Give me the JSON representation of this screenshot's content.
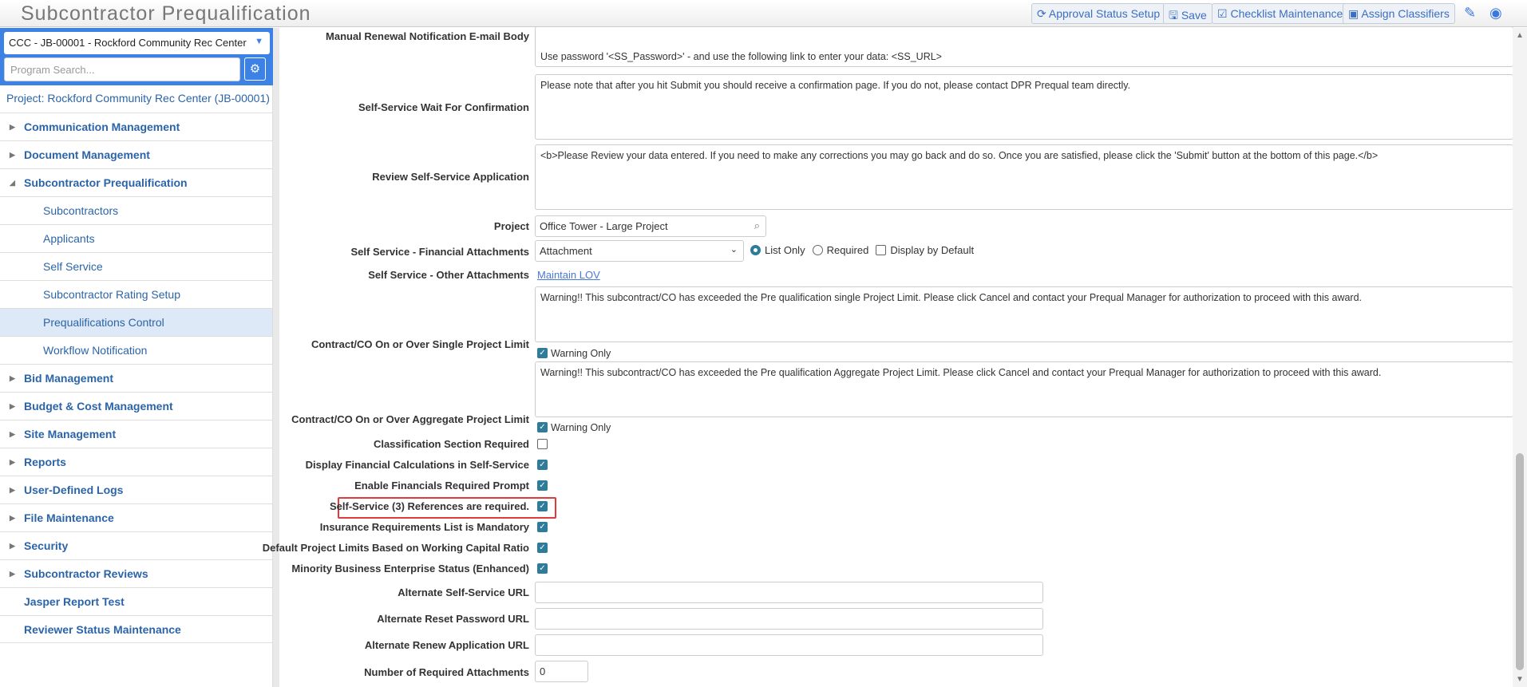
{
  "app_title": "Subcontractor Prequalification",
  "toolbar": {
    "approval": "Approval Status Setup",
    "save": "Save",
    "checklist": "Checklist Maintenance",
    "classifiers": "Assign Classifiers"
  },
  "sidebar": {
    "project_select": "CCC - JB-00001 - Rockford Community Rec Center",
    "search_placeholder": "Program Search...",
    "project_link": "Project: Rockford Community Rec Center (JB-00001)",
    "items": [
      {
        "label": "Communication Management"
      },
      {
        "label": "Document Management"
      },
      {
        "label": "Subcontractor Prequalification"
      },
      {
        "label": "Subcontractors"
      },
      {
        "label": "Applicants"
      },
      {
        "label": "Self Service"
      },
      {
        "label": "Subcontractor Rating Setup"
      },
      {
        "label": "Prequalifications Control"
      },
      {
        "label": "Workflow Notification"
      },
      {
        "label": "Bid Management"
      },
      {
        "label": "Budget & Cost Management"
      },
      {
        "label": "Site Management"
      },
      {
        "label": "Reports"
      },
      {
        "label": "User-Defined Logs"
      },
      {
        "label": "File Maintenance"
      },
      {
        "label": "Security"
      },
      {
        "label": "Subcontractor Reviews"
      },
      {
        "label": "Jasper Report Test"
      },
      {
        "label": "Reviewer Status Maintenance"
      }
    ]
  },
  "form": {
    "manual_renewal": {
      "label": "Manual Renewal Notification E-mail Body",
      "value": "Use password '<SS_Password>' - and use the following link to enter your data: <SS_URL>"
    },
    "wait_confirm": {
      "label": "Self-Service Wait For Confirmation",
      "value": "Please note that after you hit Submit you should receive a confirmation page.  If you do not, please contact DPR Prequal team directly."
    },
    "review": {
      "label": "Review Self-Service Application",
      "value": "<b>Please Review your data entered.  If you need to make any corrections you may go back and do so.  Once you are satisfied, please click the 'Submit' button at the bottom of this page.</b>"
    },
    "project": {
      "label": "Project",
      "value": "Office Tower - Large Project"
    },
    "financial": {
      "label": "Self Service - Financial Attachments",
      "value": "Attachment",
      "opt_list": "List Only",
      "opt_required": "Required",
      "opt_display": "Display by Default"
    },
    "other": {
      "label": "Self Service - Other Attachments",
      "link": "Maintain LOV"
    },
    "single": {
      "label": "Contract/CO On or Over Single Project Limit",
      "value": "Warning!! This subcontract/CO has exceeded the Pre qualification single Project Limit. Please click Cancel and contact your Prequal Manager for authorization to proceed with this award.",
      "warning": "Warning Only"
    },
    "aggregate": {
      "label": "Contract/CO On or Over Aggregate Project Limit",
      "value": "Warning!! This subcontract/CO has exceeded the Pre qualification Aggregate Project Limit. Please click Cancel and contact your Prequal Manager for authorization to proceed with this award.",
      "warning": "Warning Only"
    },
    "checks": [
      {
        "label": "Classification Section Required",
        "checked": false
      },
      {
        "label": "Display Financial Calculations in Self-Service",
        "checked": true
      },
      {
        "label": "Enable Financials Required Prompt",
        "checked": true
      },
      {
        "label": "Self-Service (3) References are required.",
        "checked": true
      },
      {
        "label": "Insurance Requirements List is Mandatory",
        "checked": true
      },
      {
        "label": "Default Project Limits Based on Working Capital Ratio",
        "checked": true
      },
      {
        "label": "Minority Business Enterprise Status (Enhanced)",
        "checked": true
      }
    ],
    "alt_ss_url": {
      "label": "Alternate Self-Service URL",
      "value": ""
    },
    "alt_reset_url": {
      "label": "Alternate Reset Password URL",
      "value": ""
    },
    "alt_renew_url": {
      "label": "Alternate Renew Application URL",
      "value": ""
    },
    "num_attachments": {
      "label": "Number of Required Attachments",
      "value": "0"
    }
  }
}
